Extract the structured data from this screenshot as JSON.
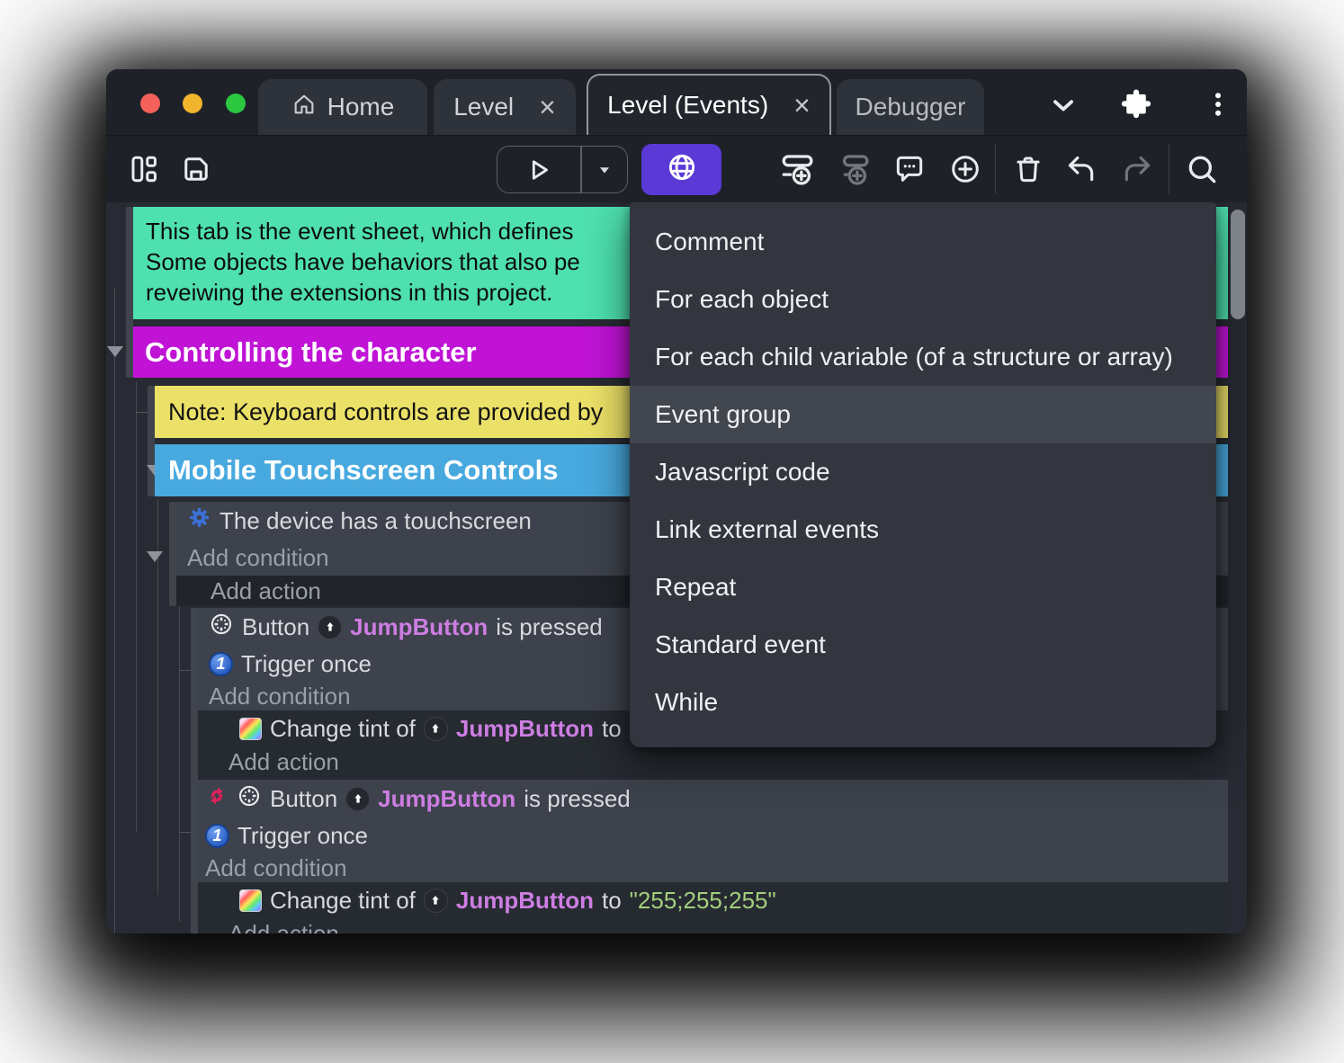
{
  "colors": {
    "comment_bg": "#4EE0AE",
    "group_bg": "#C013D6",
    "note_bg": "#ECE168",
    "subgroup_bg": "#48A9DF",
    "primary_button_bg": "#5A39D6",
    "object_name": "#CD7DE2",
    "string_value": "#A3CF7E",
    "menu_highlight": "#42464F"
  },
  "tabs": [
    {
      "label": "Home"
    },
    {
      "label": "Level",
      "close": "×"
    },
    {
      "label": "Level (Events)",
      "close": "×"
    },
    {
      "label": "Debugger"
    }
  ],
  "sheet": {
    "comment_lines": [
      "This tab is the event sheet, which defines",
      "Some objects have behaviors that also pe",
      "reveiwing the extensions in this project."
    ],
    "group_title": "Controlling the character",
    "note_text": "Note: Keyboard controls are provided by",
    "subgroup_title": "Mobile Touchscreen Controls",
    "touchscreen_condition": "The device has a touchscreen",
    "add_condition": "Add condition",
    "add_action": "Add action",
    "button_word": "Button",
    "object_name": "JumpButton",
    "is_pressed": "is pressed",
    "trigger_once": "Trigger once",
    "trigger_once_badge": "1",
    "change_tint_of": "Change tint of",
    "to_word": "to",
    "tint_value": "\"255;255;255\""
  },
  "context_menu": {
    "items": [
      "Comment",
      "For each object",
      "For each child variable (of a structure or array)",
      "Event group",
      "Javascript code",
      "Link external events",
      "Repeat",
      "Standard event",
      "While"
    ],
    "highlighted": "Event group"
  }
}
